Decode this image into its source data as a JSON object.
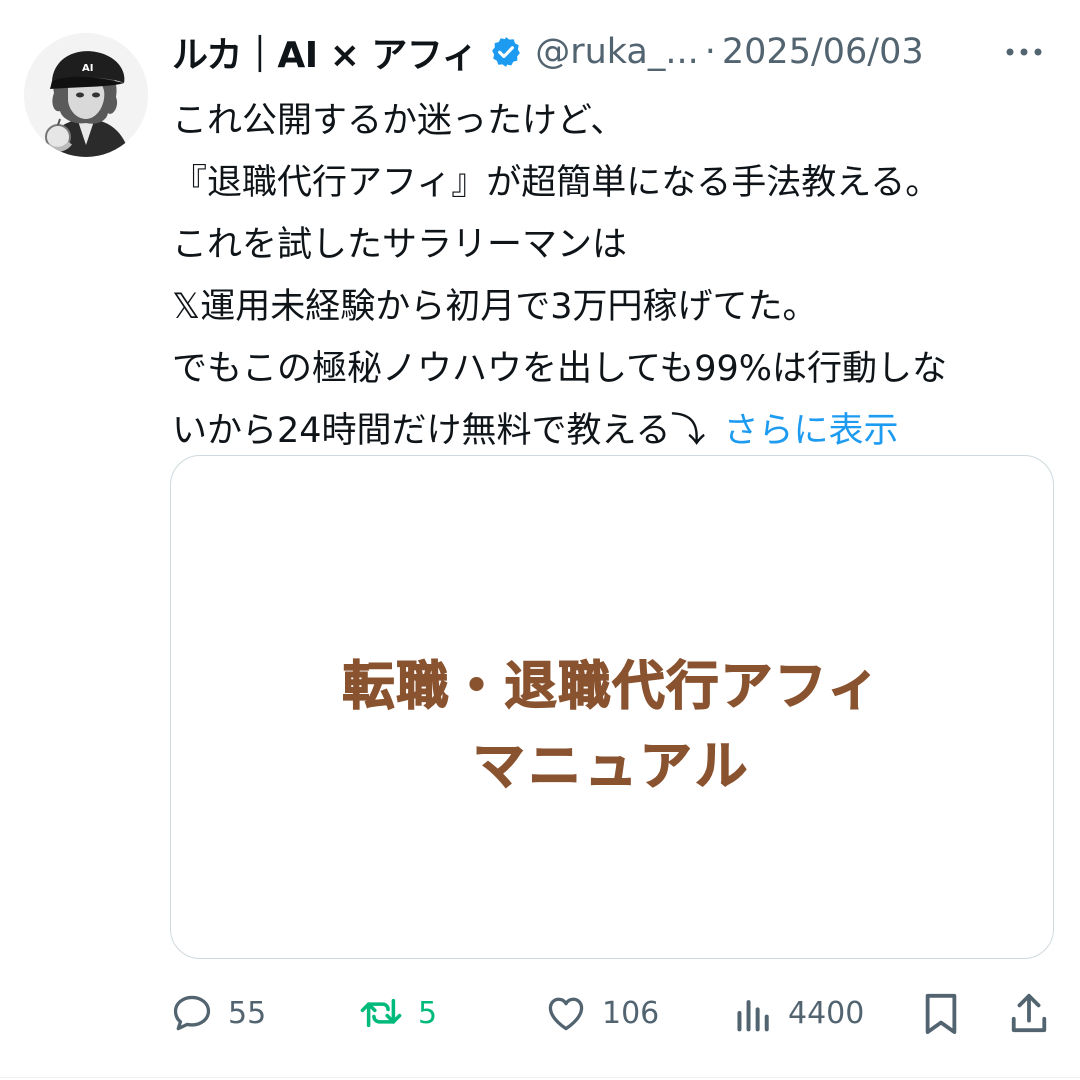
{
  "tweet": {
    "display_name": "ルカ｜AI × アフィ",
    "handle": "@ruka_...",
    "separator": "·",
    "date": "2025/06/03",
    "avatar_cap_text": "AI",
    "text_lines": [
      "これ公開するか迷ったけど、",
      "『退職代行アフィ』が超簡単になる手法教える。",
      "これを試したサラリーマンは",
      "𝕏運用未経験から初月で3万円稼げてた。",
      "でもこの極秘ノウハウを出しても99%は行動しな",
      "いから24時間だけ無料で教える⤵"
    ],
    "show_more": "さらに表示",
    "media": {
      "line1": "転職・退職代行アフィ",
      "line2": "マニュアル",
      "text_color": "#8a5330"
    }
  },
  "actions": {
    "reply": {
      "icon": "reply-icon",
      "count": "55"
    },
    "retweet": {
      "icon": "retweet-icon",
      "count": "5",
      "color": "#00ba7c"
    },
    "like": {
      "icon": "heart-icon",
      "count": "106"
    },
    "views": {
      "icon": "views-icon",
      "count": "4400"
    },
    "bookmark": {
      "icon": "bookmark-icon"
    },
    "share": {
      "icon": "share-icon"
    }
  },
  "colors": {
    "link": "#1d9bf0",
    "verified": "#1d9bf0",
    "muted": "#536471",
    "border": "#cfd9de"
  }
}
